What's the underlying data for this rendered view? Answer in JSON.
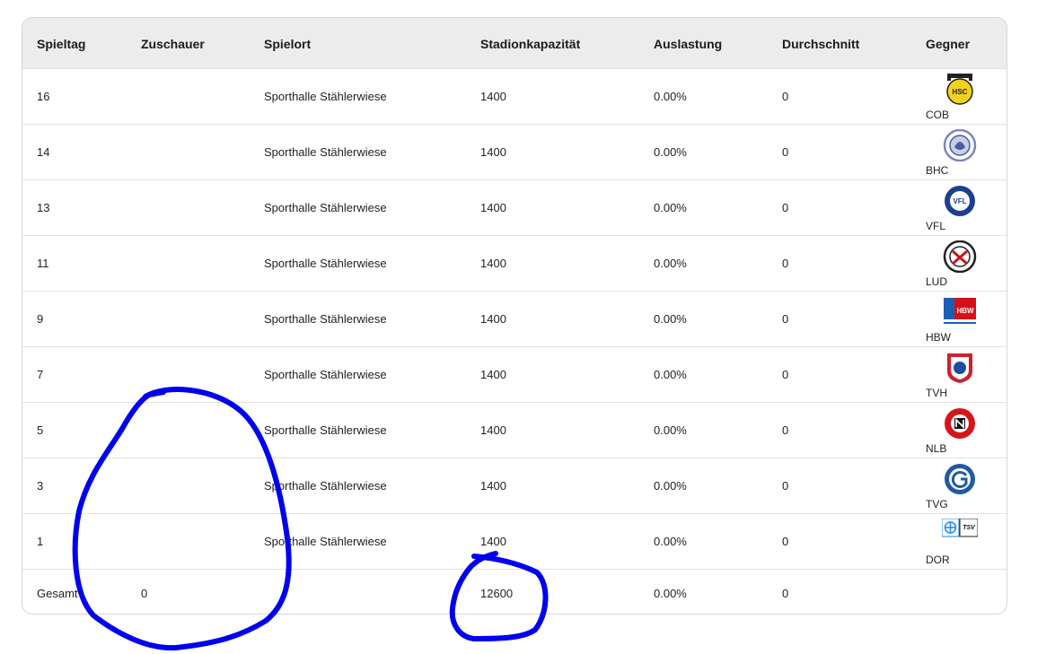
{
  "table": {
    "headers": [
      "Spieltag",
      "Zuschauer",
      "Spielort",
      "Stadionkapazität",
      "Auslastung",
      "Durchschnitt",
      "Gegner"
    ],
    "rows": [
      {
        "spieltag": "16",
        "zuschauer": "",
        "spielort": "Sporthalle Stählerwiese",
        "kapazitaet": "1400",
        "auslastung": "0.00%",
        "durchschnitt": "0",
        "gegner": "COB",
        "logo_icon": "hsc-coburg-logo-icon"
      },
      {
        "spieltag": "14",
        "zuschauer": "",
        "spielort": "Sporthalle Stählerwiese",
        "kapazitaet": "1400",
        "auslastung": "0.00%",
        "durchschnitt": "0",
        "gegner": "BHC",
        "logo_icon": "bhc-logo-icon"
      },
      {
        "spieltag": "13",
        "zuschauer": "",
        "spielort": "Sporthalle Stählerwiese",
        "kapazitaet": "1400",
        "auslastung": "0.00%",
        "durchschnitt": "0",
        "gegner": "VFL",
        "logo_icon": "vfl-logo-icon"
      },
      {
        "spieltag": "11",
        "zuschauer": "",
        "spielort": "Sporthalle Stählerwiese",
        "kapazitaet": "1400",
        "auslastung": "0.00%",
        "durchschnitt": "0",
        "gegner": "LUD",
        "logo_icon": "ludwigshafen-logo-icon"
      },
      {
        "spieltag": "9",
        "zuschauer": "",
        "spielort": "Sporthalle Stählerwiese",
        "kapazitaet": "1400",
        "auslastung": "0.00%",
        "durchschnitt": "0",
        "gegner": "HBW",
        "logo_icon": "hbw-logo-icon"
      },
      {
        "spieltag": "7",
        "zuschauer": "",
        "spielort": "Sporthalle Stählerwiese",
        "kapazitaet": "1400",
        "auslastung": "0.00%",
        "durchschnitt": "0",
        "gegner": "TVH",
        "logo_icon": "tvh-logo-icon"
      },
      {
        "spieltag": "5",
        "zuschauer": "",
        "spielort": "Sporthalle Stählerwiese",
        "kapazitaet": "1400",
        "auslastung": "0.00%",
        "durchschnitt": "0",
        "gegner": "NLB",
        "logo_icon": "nlb-logo-icon"
      },
      {
        "spieltag": "3",
        "zuschauer": "",
        "spielort": "Sporthalle Stählerwiese",
        "kapazitaet": "1400",
        "auslastung": "0.00%",
        "durchschnitt": "0",
        "gegner": "TVG",
        "logo_icon": "tvg-logo-icon"
      },
      {
        "spieltag": "1",
        "zuschauer": "",
        "spielort": "Sporthalle Stählerwiese",
        "kapazitaet": "1400",
        "auslastung": "0.00%",
        "durchschnitt": "0",
        "gegner": "DOR",
        "logo_icon": "dor-logo-icon"
      }
    ],
    "total": {
      "label": "Gesamt",
      "zuschauer": "0",
      "spielort": "",
      "kapazitaet": "12600",
      "auslastung": "0.00%",
      "durchschnitt": "0"
    }
  },
  "logo_text": {
    "COB": "HSC",
    "VFL": "VFL",
    "HBW": "HBW",
    "DOR": "TSV"
  },
  "annotation": {
    "color": "#0000ee",
    "shapes": [
      "freehand-circle",
      "freehand-circle"
    ]
  }
}
